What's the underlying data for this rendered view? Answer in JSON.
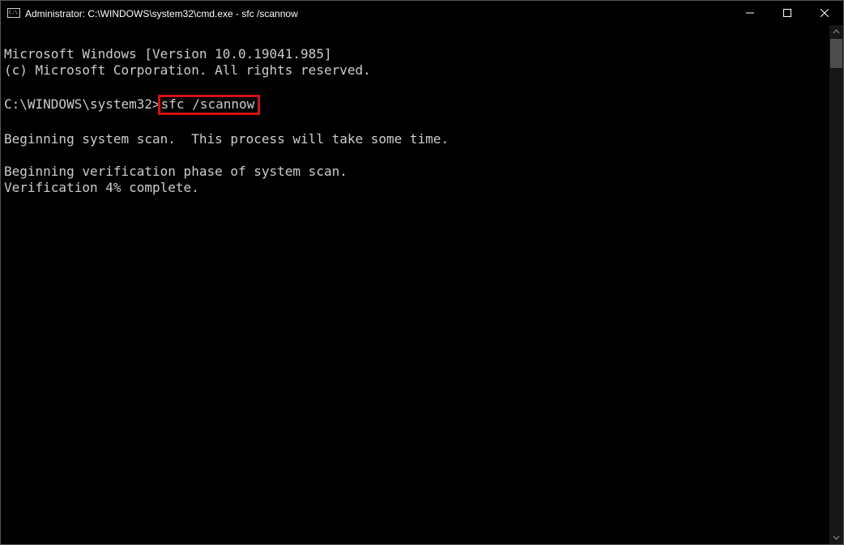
{
  "title": "Administrator: C:\\WINDOWS\\system32\\cmd.exe - sfc  /scannow",
  "highlight_color": "#d21212",
  "console": {
    "version_line": "Microsoft Windows [Version 10.0.19041.985]",
    "copyright_line": "(c) Microsoft Corporation. All rights reserved.",
    "prompt": "C:\\WINDOWS\\system32>",
    "command": "sfc /scannow",
    "scan_begin": "Beginning system scan.  This process will take some time.",
    "verify_begin": "Beginning verification phase of system scan.",
    "verify_progress": "Verification 4% complete."
  }
}
